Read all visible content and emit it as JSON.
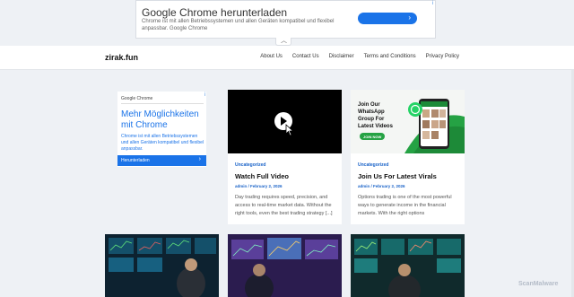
{
  "top_ad": {
    "title": "Google Chrome herunterladen",
    "description": "Chrome ist mit allen Betriebssystemen und allen Geräten kompatibel und flexibel anpassbar. Google Chrome",
    "button_icon": "chevron-right-icon",
    "ad_mark": "i",
    "collapse_icon": "chevron-up-icon",
    "collapse_glyph": "︿"
  },
  "header": {
    "site_title": "zirak.fun",
    "nav": [
      "About Us",
      "Contact Us",
      "Disclaimer",
      "Terms and Conditions",
      "Privacy Policy"
    ]
  },
  "side_ad": {
    "brand": "Google Chrome",
    "headline": "Mehr Möglichkeiten mit Chrome",
    "description": "Chrome ist mit allen Betriebssystemen und allen Geräten kompatibel und flexibel anpassbar.",
    "button_label": "Herunterladen",
    "button_arrow": "›",
    "ad_mark": "i"
  },
  "cards": [
    {
      "category": "Uncategorized",
      "title": "Watch Full Video",
      "meta": "admin / February 2, 2026",
      "excerpt": "Day trading requires speed, precision, and access to real-time market data. Without the right tools, even the best trading strategy [...]"
    },
    {
      "category": "Uncategorized",
      "title": "Join Us For Latest Virals",
      "meta": "admin / February 2, 2026",
      "excerpt": "Options trading is one of the most powerful ways to generate income in the financial markets. With the right options",
      "promo_text": "Join Our WhatsApp Group For Latest Videos",
      "promo_button": "JOIN NOW"
    }
  ],
  "watermark": "ScanMalware",
  "colors": {
    "accent": "#1a73e8",
    "link": "#1a63c8",
    "page_bg": "#eef1f5",
    "whatsapp_green": "#25a244"
  }
}
